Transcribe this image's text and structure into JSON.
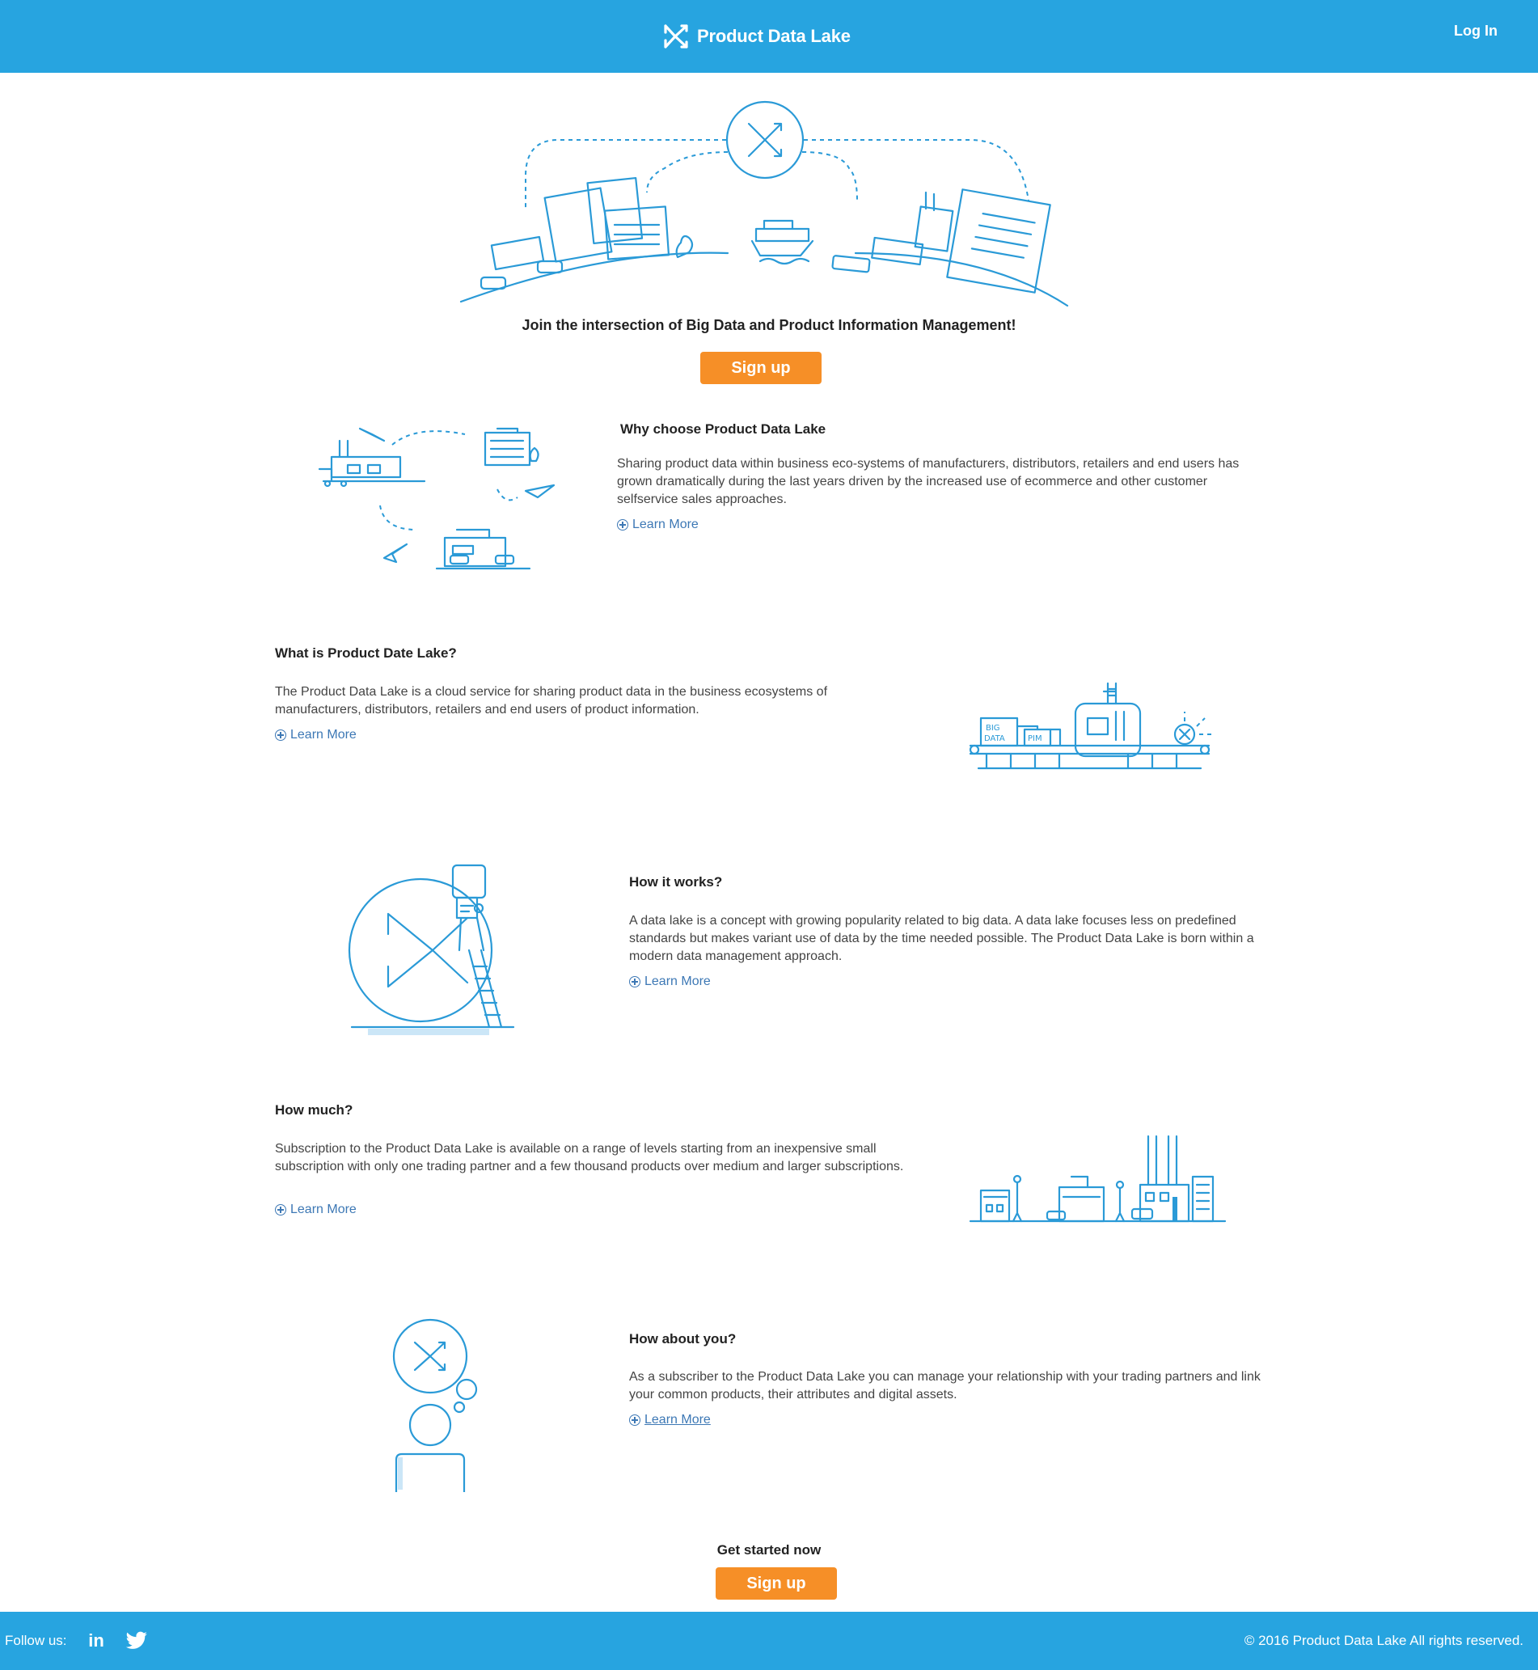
{
  "header": {
    "brand": "Product Data Lake",
    "login_label": "Log In"
  },
  "hero": {
    "tagline": "Join the intersection of Big Data and Product Information Management!",
    "signup_label": "Sign up"
  },
  "sections": [
    {
      "title": "Why choose Product Data Lake",
      "text": "Sharing product data within business eco-systems of manufacturers, distributors, retailers and end users has grown dramatically during the last years driven by the increased use of ecommerce and other customer selfservice sales approaches.",
      "link": "Learn More"
    },
    {
      "title": "What is Product Date Lake?",
      "text": "The Product Data Lake is a cloud service for sharing product data in the business ecosystems of manufacturers, distributors, retailers and end users of product information.",
      "link": "Learn More"
    },
    {
      "title": "How it works?",
      "text": "A data lake is a concept with growing popularity related to big data. A data lake focuses less on predefined standards but makes variant use of data by the time needed possible. The Product Data Lake is born within a modern data management approach.",
      "link": "Learn More"
    },
    {
      "title": "How much?",
      "text": "Subscription to the Product Data Lake is available on a range of levels starting from an inexpensive small subscription with only one trading partner and a few thousand products over medium and larger subscriptions.",
      "link": "Learn More"
    },
    {
      "title": "How about you?",
      "text": "As a subscriber to the Product Data Lake you can manage your relationship with your trading partners and link your common products, their attributes and digital assets.",
      "link": "Learn More"
    }
  ],
  "illustration_labels": {
    "big": "BIG",
    "data": "DATA",
    "pim": "PIM"
  },
  "cta": {
    "title": "Get started now",
    "signup_label": "Sign up"
  },
  "footer": {
    "follow_label": "Follow us:",
    "linkedin_glyph": "in",
    "copyright": "© 2016 Product Data Lake All rights reserved."
  },
  "colors": {
    "brand_blue": "#27a4e0",
    "button_orange": "#f68f27",
    "link_blue": "#3d78b5"
  },
  "icons": [
    "logo-icon",
    "plus-circle-icon",
    "linkedin-icon",
    "twitter-icon"
  ]
}
